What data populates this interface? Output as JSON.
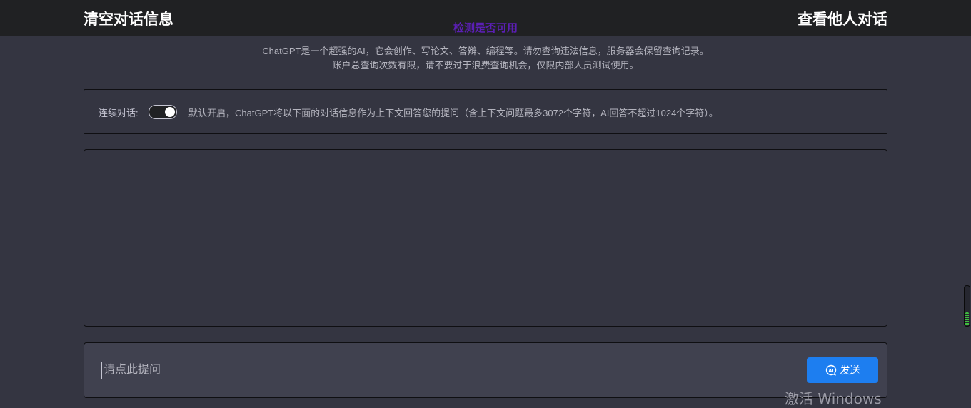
{
  "header": {
    "clear_label": "清空对话信息",
    "check_label": "检测是否可用",
    "view_others_label": "查看他人对话"
  },
  "notice": {
    "line1": "ChatGPT是一个超强的AI，它会创作、写论文、答辩、编程等。请勿查询违法信息，服务器会保留查询记录。",
    "line2": "账户总查询次数有限，请不要过于浪费查询机会，仅限内部人员测试使用。"
  },
  "continuous": {
    "label": "连续对话:",
    "enabled": true,
    "description": "默认开启，ChatGPT将以下面的对话信息作为上下文回答您的提问（含上下文问题最多3072个字符，AI回答不超过1024个字符）。"
  },
  "input": {
    "placeholder": "请点此提问",
    "value": ""
  },
  "send_button": {
    "label": "发送",
    "icon": "ai-chat-icon",
    "color": "#1d7ef0"
  },
  "watermark": "激活 Windows",
  "colors": {
    "background": "#343541",
    "topbar": "#202123",
    "check_link": "#5b1fb4"
  }
}
